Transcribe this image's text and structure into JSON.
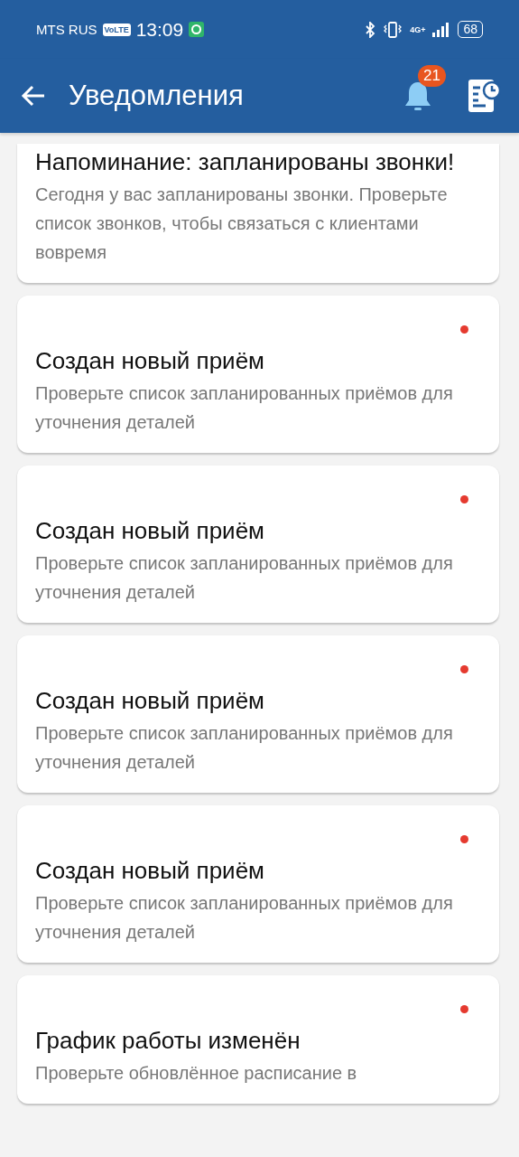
{
  "status_bar": {
    "carrier": "MTS RUS",
    "volte": "VoLTE",
    "time": "13:09",
    "network": "4G+",
    "battery": "68"
  },
  "header": {
    "title": "Уведомления",
    "badge": "21"
  },
  "notifications": [
    {
      "title": "Напоминание: запланированы звонки!",
      "body": "Сегодня у вас запланированы звонки. Проверьте список звонков, чтобы связаться с клиентами вовремя",
      "unread": false
    },
    {
      "title": "Создан новый приём",
      "body": "Проверьте список запланированных приёмов для уточнения деталей",
      "unread": true
    },
    {
      "title": "Создан новый приём",
      "body": "Проверьте список запланированных приёмов для уточнения деталей",
      "unread": true
    },
    {
      "title": "Создан новый приём",
      "body": "Проверьте список запланированных приёмов для уточнения деталей",
      "unread": true
    },
    {
      "title": "Создан новый приём",
      "body": "Проверьте список запланированных приёмов для уточнения деталей",
      "unread": true
    },
    {
      "title": "График работы изменён",
      "body": "Проверьте обновлённое расписание в",
      "unread": true
    }
  ]
}
